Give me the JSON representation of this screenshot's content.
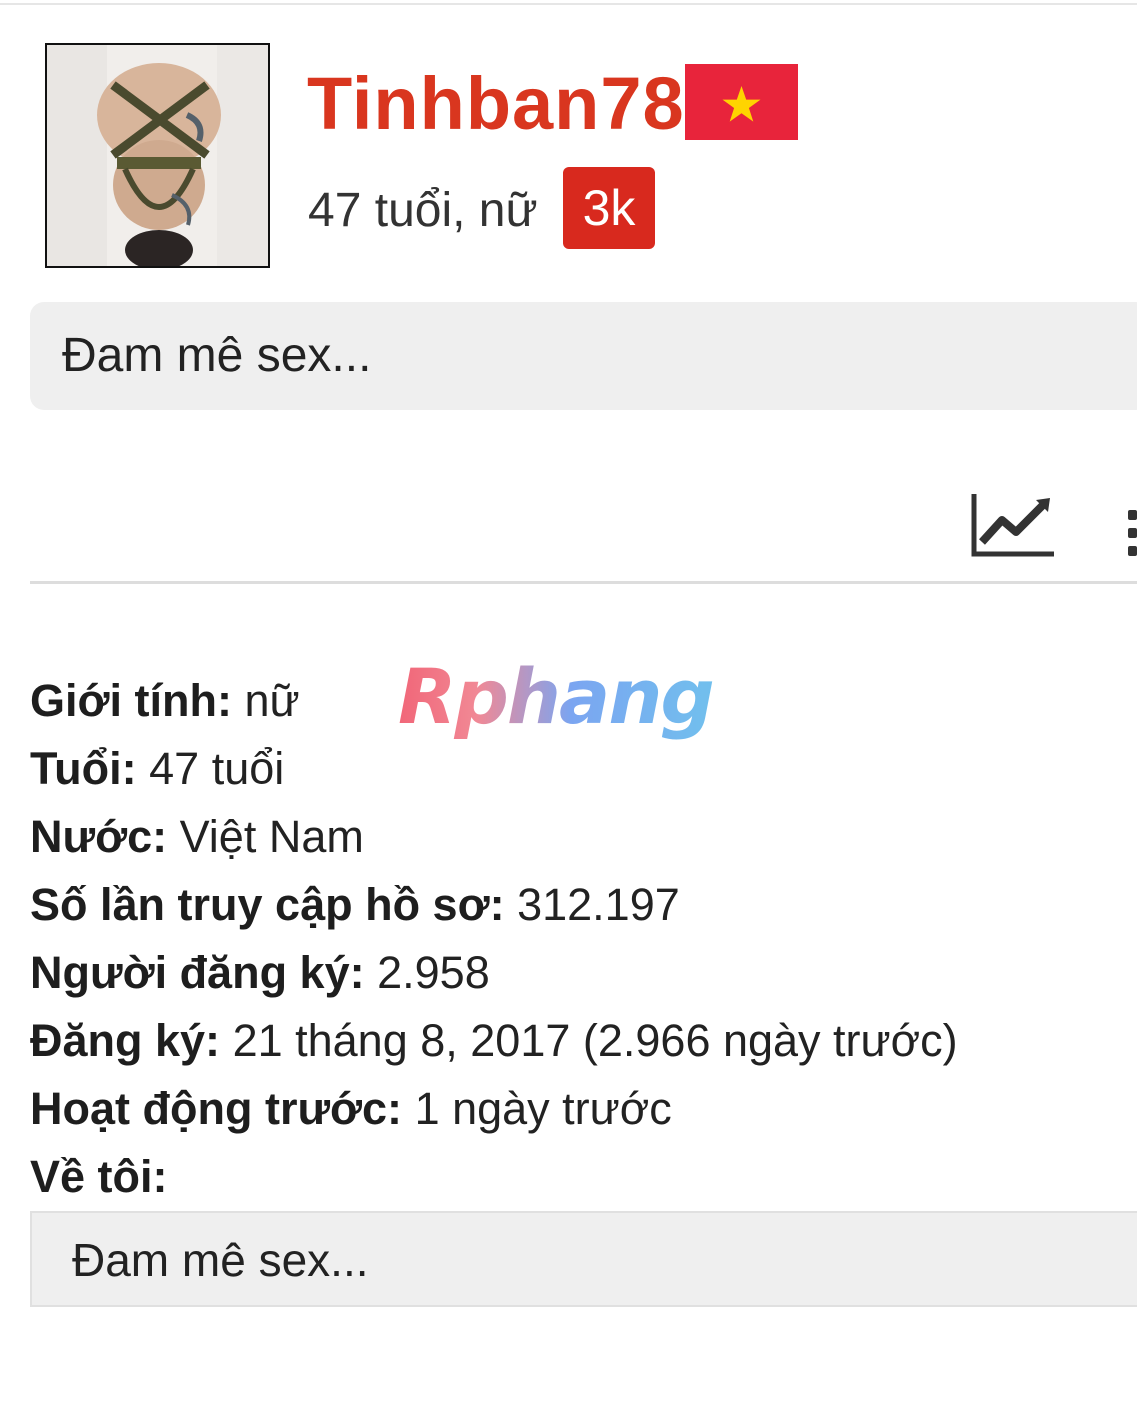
{
  "profile": {
    "username": "Tinhban78",
    "age_gender": "47 tuổi, nữ",
    "badge": "3k",
    "status": "Đam mê sex...",
    "flag_icon": "vietnam-flag-icon",
    "flag_color": "#da251d",
    "star_color": "#ffdd00",
    "accent_color": "#d9361f"
  },
  "toolbar": {
    "stats_icon": "trend-chart-icon",
    "more_icon": "more-dots-icon"
  },
  "details": [
    {
      "label": "Giới tính:",
      "value": "nữ"
    },
    {
      "label": "Tuổi:",
      "value": "47 tuổi"
    },
    {
      "label": "Nước:",
      "value": "Việt Nam"
    },
    {
      "label": "Số lần truy cập hồ sơ:",
      "value": "312.197"
    },
    {
      "label": "Người đăng ký:",
      "value": "2.958"
    },
    {
      "label": "Đăng ký:",
      "value": "21 tháng 8, 2017 (2.966 ngày trước)"
    },
    {
      "label": "Hoạt động trước:",
      "value": "1 ngày trước"
    },
    {
      "label": "Về tôi:",
      "value": ""
    }
  ],
  "about": {
    "text": "Đam mê sex..."
  },
  "watermark": "Rphang"
}
